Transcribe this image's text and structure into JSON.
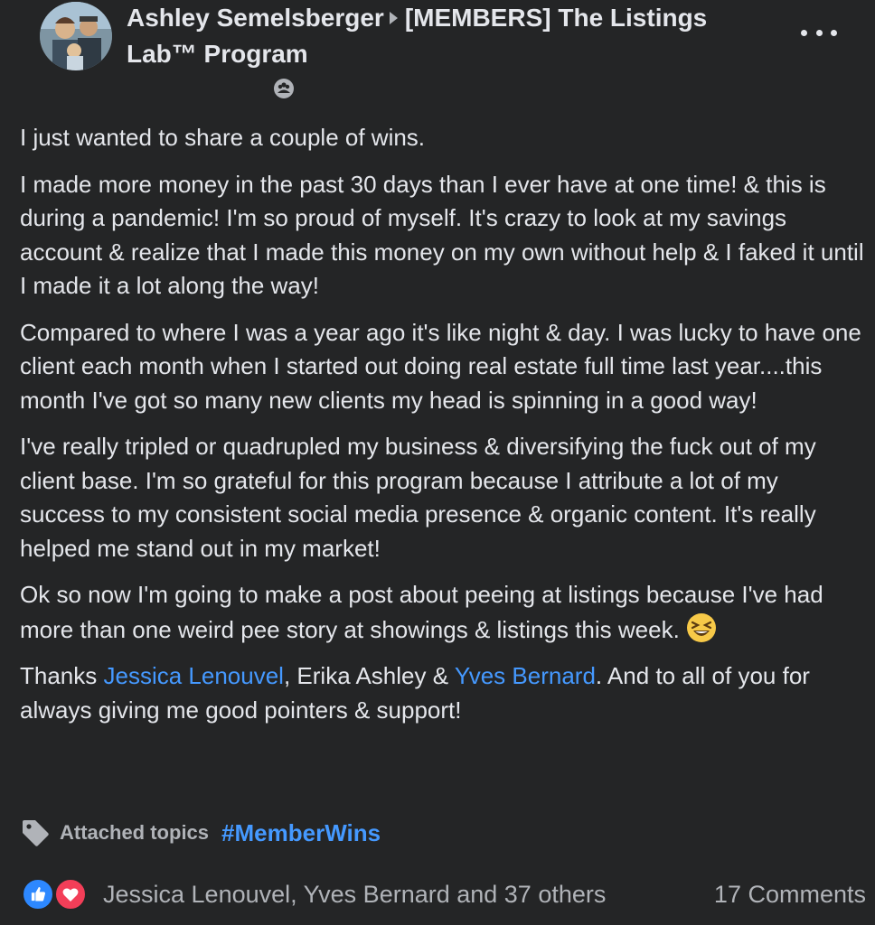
{
  "header": {
    "author": "Ashley Semelsberger",
    "group": "[MEMBERS] The Listings Lab™ Program",
    "privacy_icon": "group-members-icon",
    "more_icon": "more-options-icon"
  },
  "body": {
    "p1": "I just wanted to share a couple of wins.",
    "p2": "I made more money in the past 30 days than I ever have at one time! & this is during a pandemic! I'm so proud of myself. It's crazy to look at my savings account & realize that I made this money on my own without help & I faked it until I made it a lot along the way!",
    "p3": "Compared to where I was a year ago it's like night & day. I was lucky to have one client each month when I started out doing real estate full time last year....this month I've got so many new clients my head is spinning in a good way!",
    "p4": "I've really tripled or quadrupled my business & diversifying the fuck out of my client base. I'm so grateful for this program because I attribute a lot of my success to my consistent social media presence & organic content. It's really helped me stand out in my market!",
    "p5": "Ok so now I'm going to make a post about peeing at listings because I've had more than one weird pee story at showings & listings this week.",
    "p5_emoji": "laughing-face-emoji",
    "p6_prefix": "Thanks ",
    "mention1": "Jessica Lenouvel",
    "p6_mid": ", Erika Ashley & ",
    "mention2": "Yves Bernard",
    "p6_suffix": ". And to all of you for always giving me good pointers & support!"
  },
  "topics": {
    "label": "Attached topics",
    "tag": "#MemberWins",
    "icon": "tag-icon"
  },
  "footer": {
    "reactors": "Jessica Lenouvel, Yves Bernard and 37 others",
    "comments": "17 Comments",
    "reaction_icons": [
      "like-reaction-icon",
      "love-reaction-icon"
    ]
  },
  "colors": {
    "background": "#242526",
    "text": "#e4e6eb",
    "secondary": "#b0b3b8",
    "link": "#4599ff"
  }
}
